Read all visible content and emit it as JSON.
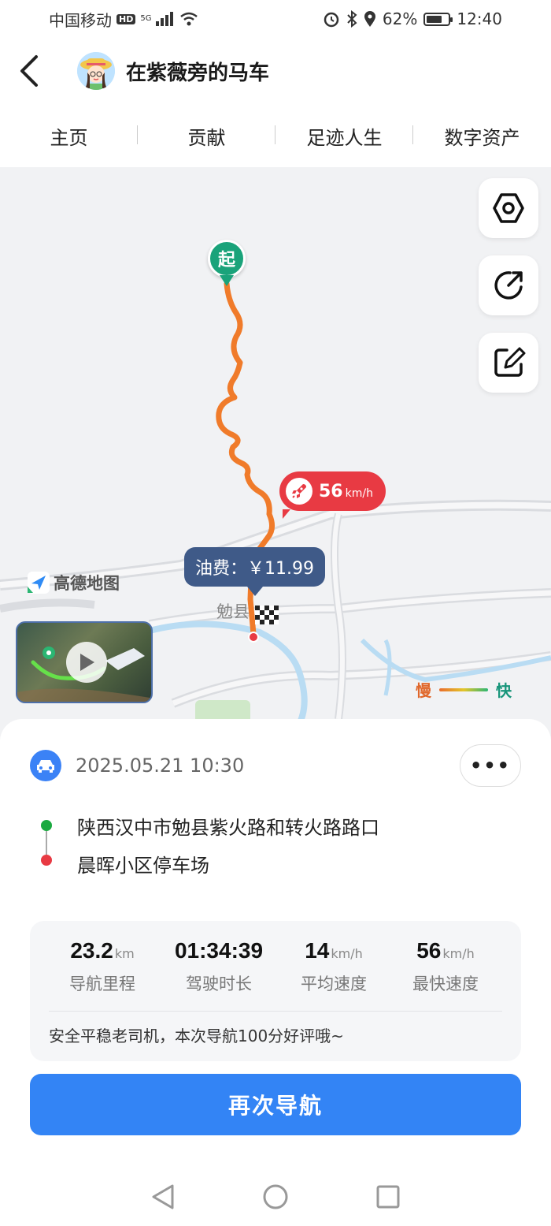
{
  "status_bar": {
    "carrier": "中国移动",
    "hd": "HD",
    "network": "5G",
    "battery_percent": "62%",
    "time": "12:40"
  },
  "header": {
    "title": "在紫薇旁的马车"
  },
  "tabs": [
    {
      "label": "主页"
    },
    {
      "label": "贡献"
    },
    {
      "label": "足迹人生"
    },
    {
      "label": "数字资产"
    }
  ],
  "map": {
    "start_marker": "起",
    "max_speed_value": "56",
    "max_speed_unit": "km/h",
    "fuel_cost": "油费：￥11.99",
    "provider": "高德地图",
    "town_label": "勉县",
    "legend_slow": "慢",
    "legend_fast": "快",
    "route_color": "#f07b2a"
  },
  "trip": {
    "datetime": "2025.05.21 10:30",
    "more": "•••",
    "start_address": "陕西汉中市勉县紫火路和转火路路口",
    "end_address": "晨晖小区停车场",
    "stats": [
      {
        "value": "23.2",
        "unit": "km",
        "label": "导航里程"
      },
      {
        "value": "01:34:39",
        "unit": "",
        "label": "驾驶时长"
      },
      {
        "value": "14",
        "unit": "km/h",
        "label": "平均速度"
      },
      {
        "value": "56",
        "unit": "km/h",
        "label": "最快速度"
      }
    ],
    "comment": "安全平稳老司机，本次导航100分好评哦~",
    "navigate_again": "再次导航"
  },
  "colors": {
    "accent": "#3384f5",
    "start_green": "#1aa37a",
    "end_red": "#e83a43"
  }
}
